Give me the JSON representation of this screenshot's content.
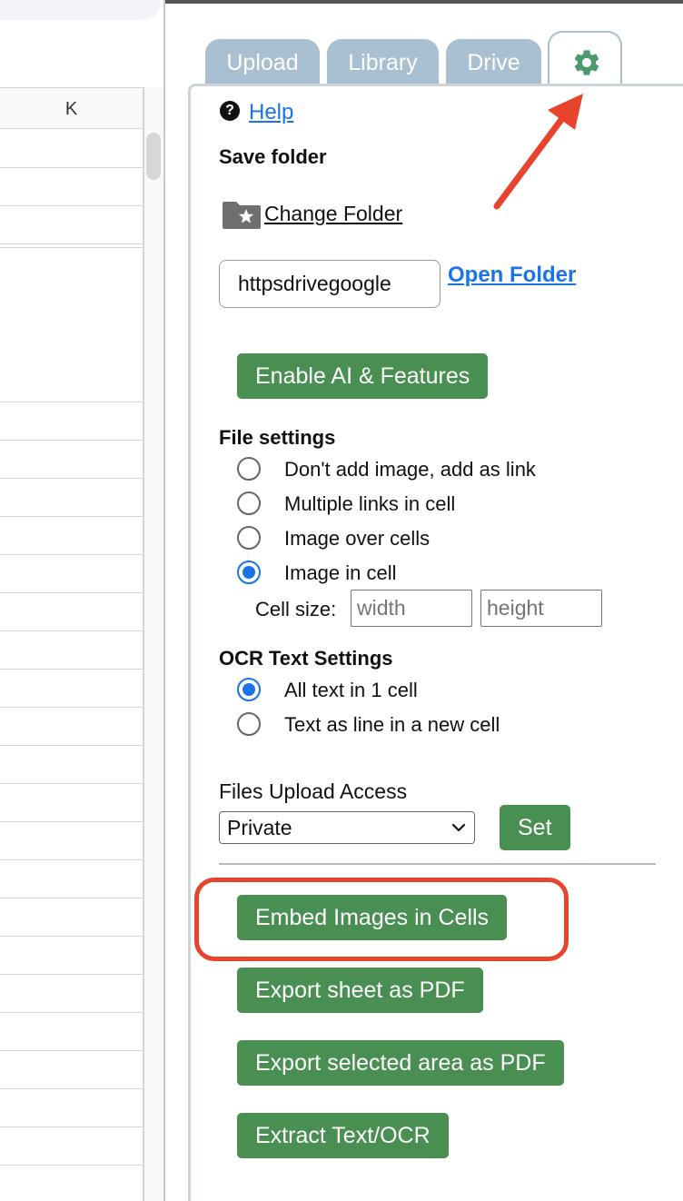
{
  "sheet": {
    "column_header": "K"
  },
  "tabs": [
    {
      "label": "Upload"
    },
    {
      "label": "Library"
    },
    {
      "label": "Drive"
    }
  ],
  "settings_tab": {
    "icon": "gear-icon",
    "active": true,
    "icon_color": "#4a9a6e"
  },
  "help": {
    "icon": "question-icon",
    "label": "Help"
  },
  "save_folder": {
    "title": "Save folder",
    "change_label": "Change Folder",
    "url_value": "httpsdrivegoogle",
    "open_label": "Open Folder"
  },
  "enable_button": {
    "label": "Enable AI & Features"
  },
  "file_settings": {
    "title": "File settings",
    "options": [
      {
        "label": "Don't add image, add as link",
        "checked": false
      },
      {
        "label": "Multiple links in cell",
        "checked": false
      },
      {
        "label": "Image over cells",
        "checked": false
      },
      {
        "label": "Image in cell",
        "checked": true
      }
    ],
    "cell_size_label": "Cell size:",
    "width_placeholder": "width",
    "height_placeholder": "height"
  },
  "ocr_settings": {
    "title": "OCR Text Settings",
    "options": [
      {
        "label": "All text in 1 cell",
        "checked": true
      },
      {
        "label": "Text as line in a new cell",
        "checked": false
      }
    ]
  },
  "upload_access": {
    "title": "Files Upload Access",
    "selected": "Private",
    "set_label": "Set"
  },
  "actions": {
    "embed_label": "Embed Images in Cells",
    "export_sheet_label": "Export sheet as PDF",
    "export_area_label": "Export selected area as PDF",
    "extract_label": "Extract Text/OCR"
  },
  "colors": {
    "button_green": "#4a8f52",
    "link_blue": "#1a73e8",
    "tab_inactive": "#a9bfd2",
    "annotation_red": "#e8432d"
  }
}
